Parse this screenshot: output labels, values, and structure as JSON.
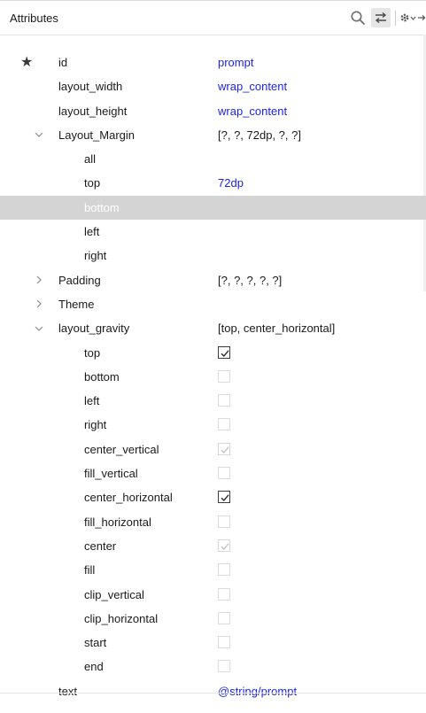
{
  "header": {
    "title": "Attributes",
    "icons": [
      "search-icon",
      "swap-icon",
      "gear-icon",
      "pin-icon"
    ]
  },
  "rows": {
    "id": {
      "name": "id",
      "value": "prompt"
    },
    "layout_width": {
      "name": "layout_width",
      "value": "wrap_content"
    },
    "layout_height": {
      "name": "layout_height",
      "value": "wrap_content"
    },
    "layout_margin": {
      "name": "Layout_Margin",
      "value": "[?, ?, 72dp, ?, ?]"
    },
    "margin_all": {
      "name": "all",
      "value": ""
    },
    "margin_top": {
      "name": "top",
      "value": "72dp"
    },
    "margin_bottom": {
      "name": "bottom",
      "value": ""
    },
    "margin_left": {
      "name": "left",
      "value": ""
    },
    "margin_right": {
      "name": "right",
      "value": ""
    },
    "padding": {
      "name": "Padding",
      "value": "[?, ?, ?, ?, ?]"
    },
    "theme": {
      "name": "Theme",
      "value": ""
    },
    "layout_gravity": {
      "name": "layout_gravity",
      "value": "[top, center_horizontal]"
    },
    "gravity_options": [
      {
        "name": "top",
        "state": "checked"
      },
      {
        "name": "bottom",
        "state": "unchecked"
      },
      {
        "name": "left",
        "state": "unchecked"
      },
      {
        "name": "right",
        "state": "unchecked"
      },
      {
        "name": "center_vertical",
        "state": "implied"
      },
      {
        "name": "fill_vertical",
        "state": "unchecked"
      },
      {
        "name": "center_horizontal",
        "state": "checked"
      },
      {
        "name": "fill_horizontal",
        "state": "unchecked"
      },
      {
        "name": "center",
        "state": "implied"
      },
      {
        "name": "fill",
        "state": "unchecked"
      },
      {
        "name": "clip_vertical",
        "state": "unchecked"
      },
      {
        "name": "clip_horizontal",
        "state": "unchecked"
      },
      {
        "name": "start",
        "state": "unchecked"
      },
      {
        "name": "end",
        "state": "unchecked"
      }
    ],
    "text": {
      "name": "text",
      "value": "@string/prompt"
    }
  },
  "colors": {
    "value_blue": "#1b24e6",
    "selected_row": "#d4d4d4"
  }
}
